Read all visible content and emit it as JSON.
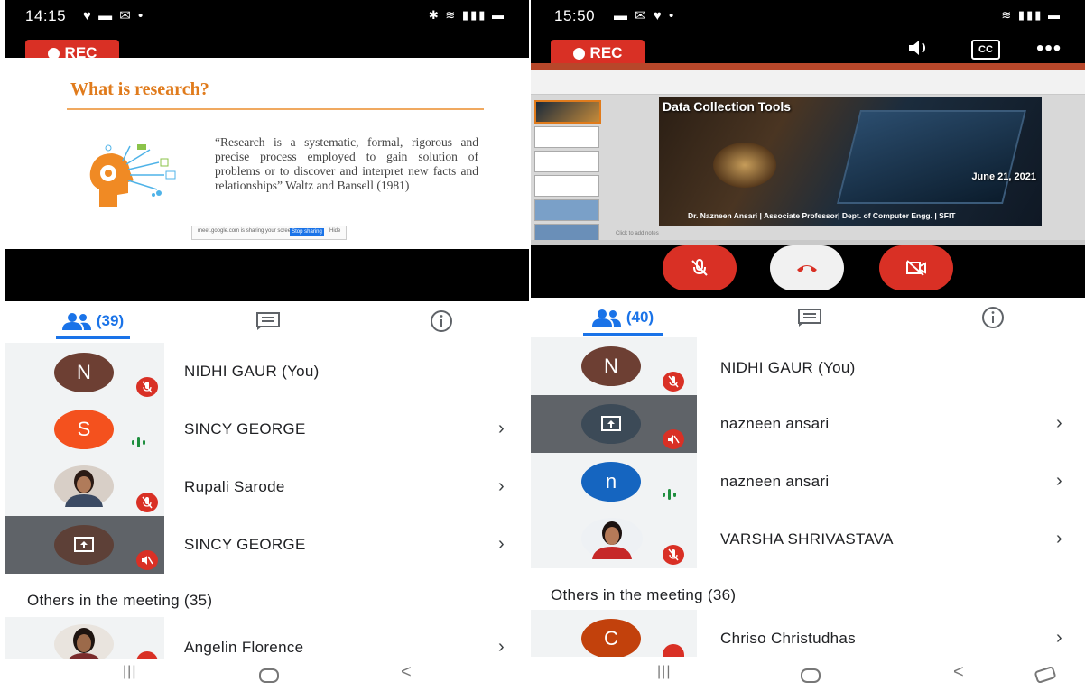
{
  "left": {
    "status": {
      "time": "14:15",
      "icons": "♥ ▬ ✉ •",
      "sys": "✱ ≋ ▮▮▮ ▬"
    },
    "rec_label": "REC",
    "slide": {
      "title": "What is research?",
      "quote": "“Research is a systematic, formal, rigorous and precise process employed to gain solution of problems or to discover and interpret new facts and relationships” Waltz and Bansell (1981)",
      "share_text": "meet.google.com is sharing your screen.",
      "share_stop": "Stop sharing",
      "share_hide": "Hide"
    },
    "tabs": {
      "people_count": "(39)"
    },
    "participants": [
      {
        "initial": "N",
        "name": "NIDHI GAUR (You)",
        "color": "#6d3f33",
        "muted": true,
        "chevron": false,
        "type": "letter"
      },
      {
        "initial": "S",
        "name": "SINCY GEORGE",
        "color": "#f4511e",
        "muted": false,
        "chevron": true,
        "type": "letter",
        "speaking": true
      },
      {
        "initial": "",
        "name": "Rupali Sarode",
        "color": "#8a6a55",
        "muted": true,
        "chevron": true,
        "type": "photo"
      },
      {
        "initial": "",
        "name": "SINCY GEORGE",
        "color": "#5d4037",
        "muted": true,
        "chevron": true,
        "type": "screen"
      }
    ],
    "others_label": "Others in the meeting (35)",
    "others": [
      {
        "name": "Angelin Florence",
        "type": "photo",
        "color": "#6a4a3a"
      }
    ]
  },
  "right": {
    "status": {
      "time": "15:50",
      "icons": "▬ ✉ ♥ •",
      "sys": "≋ ▮▮▮ ▬"
    },
    "rec_label": "REC",
    "cc_label": "CC",
    "slide": {
      "title": "Data Collection Tools",
      "date": "June 21, 2021",
      "author": "Dr. Nazneen Ansari | Associate Professor| Dept. of Computer Engg. | SFIT",
      "notes": "Click to add notes"
    },
    "tabs": {
      "people_count": "(40)"
    },
    "participants": [
      {
        "initial": "N",
        "name": "NIDHI GAUR (You)",
        "color": "#6d3f33",
        "muted": true,
        "chevron": false,
        "type": "letter"
      },
      {
        "initial": "",
        "name": "nazneen ansari",
        "color": "#3c4a57",
        "muted": true,
        "chevron": true,
        "type": "screen"
      },
      {
        "initial": "n",
        "name": "nazneen ansari",
        "color": "#1565c0",
        "muted": false,
        "chevron": true,
        "type": "letter",
        "speaking": true
      },
      {
        "initial": "",
        "name": "VARSHA SHRIVASTAVA",
        "color": "#c62828",
        "muted": true,
        "chevron": true,
        "type": "photo"
      }
    ],
    "others_label": "Others in the meeting (36)",
    "others": [
      {
        "initial": "C",
        "name": "Chriso Christudhas",
        "type": "letter",
        "color": "#c2410c"
      }
    ]
  },
  "nav": {
    "recents": "|||",
    "back": "<"
  }
}
